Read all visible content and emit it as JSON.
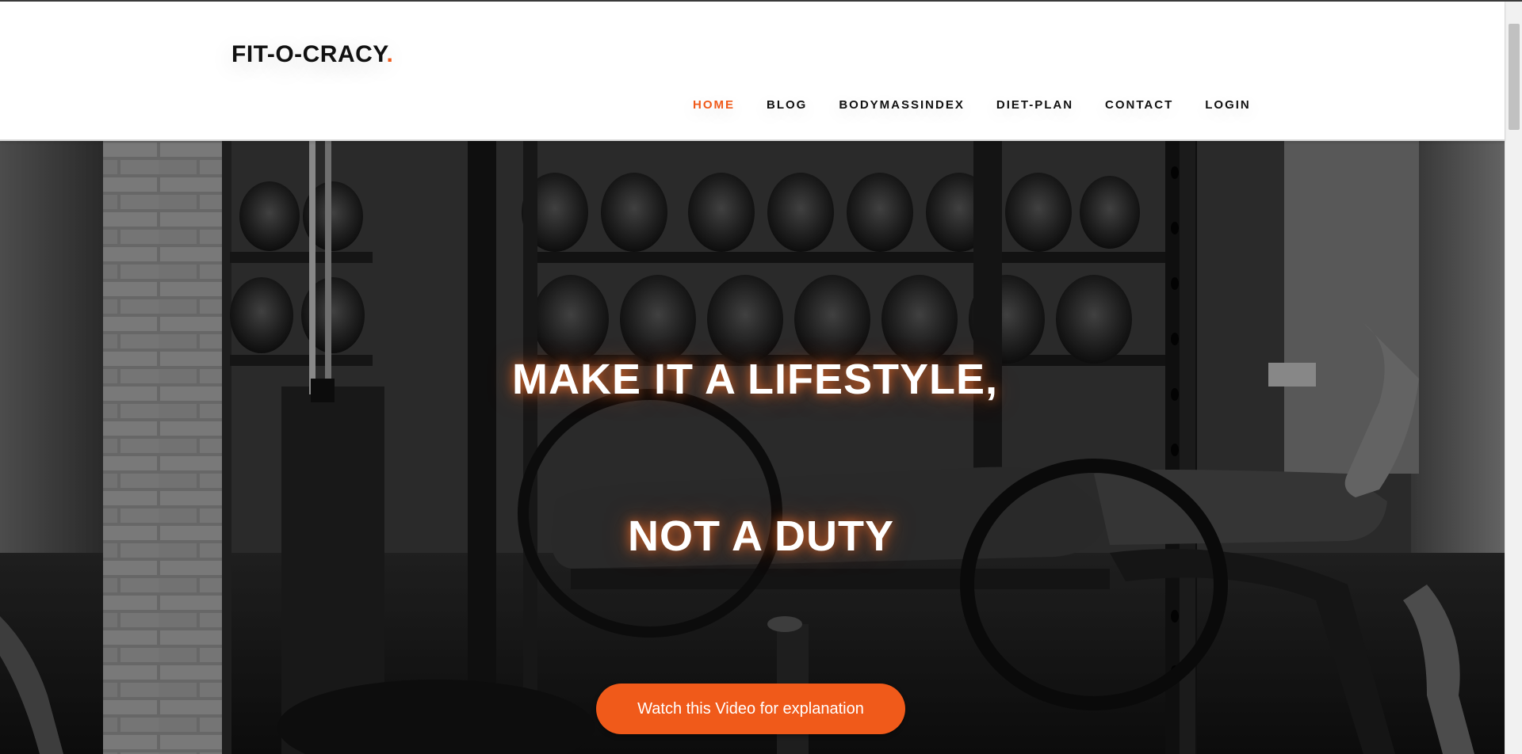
{
  "header": {
    "logo_text": "FIT-O-CRACY",
    "logo_dot": ".",
    "nav": [
      {
        "label": "HOME",
        "active": true
      },
      {
        "label": "BLOG",
        "active": false
      },
      {
        "label": "BODYMASSINDEX",
        "active": false
      },
      {
        "label": "DIET-PLAN",
        "active": false
      },
      {
        "label": "CONTACT",
        "active": false
      },
      {
        "label": "LOGIN",
        "active": false
      }
    ]
  },
  "hero": {
    "background_icon": "gym-equipment-photo",
    "headline_line1": "MAKE IT A LIFESTYLE,",
    "headline_line2": "NOT A DUTY",
    "cta_label": "Watch this Video for explanation"
  },
  "colors": {
    "accent": "#f05a1a",
    "text_dark": "#111111",
    "hero_text": "#ffffff"
  }
}
